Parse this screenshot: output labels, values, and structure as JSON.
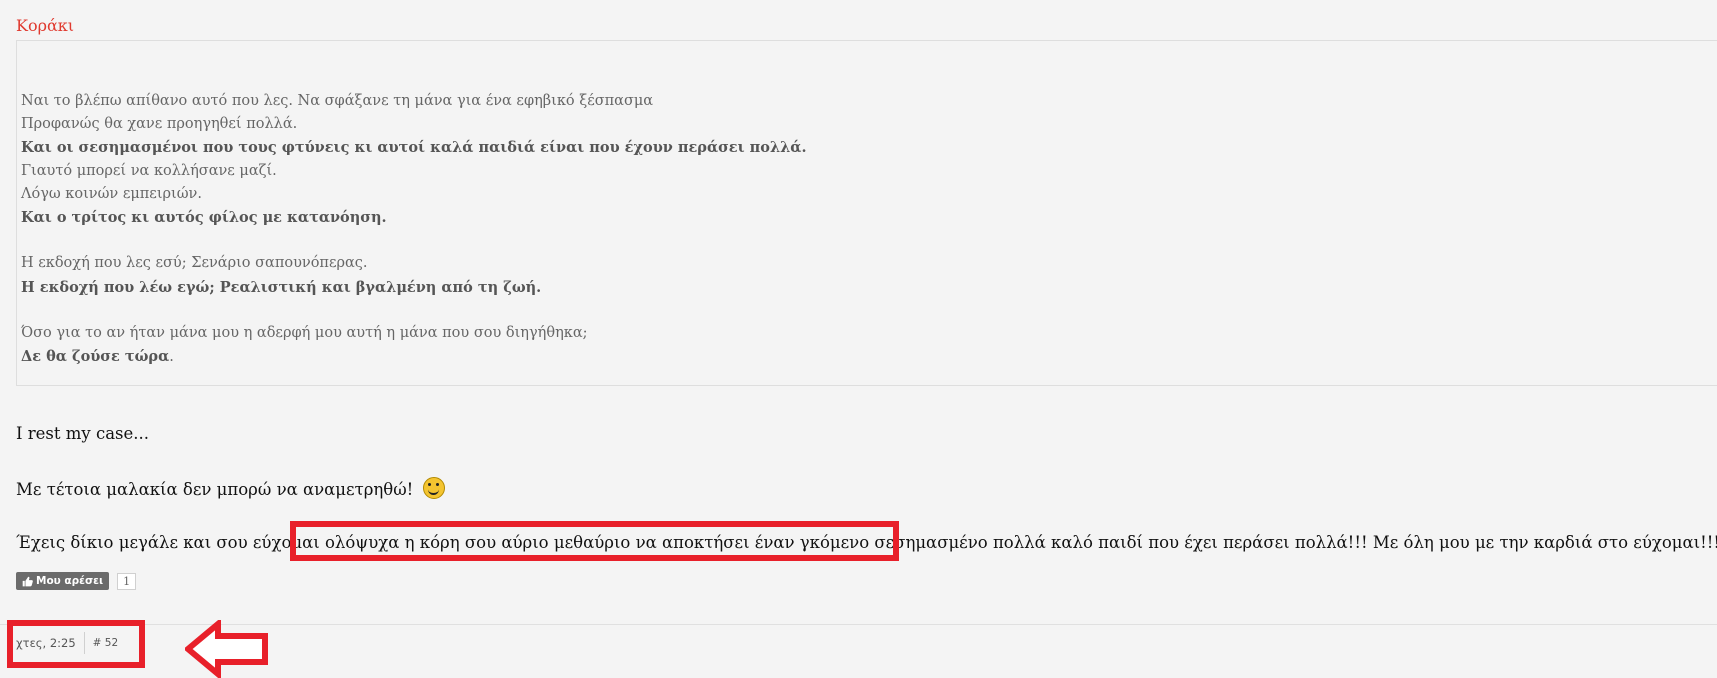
{
  "quote": {
    "author": "Κοράκι",
    "lines": [
      {
        "text": "Ναι το βλέπω απίθανο αυτό που λες. Να σφάξανε τη μάνα για ένα εφηβικό ξέσπασμα",
        "bold": false
      },
      {
        "text": "Προφανώς θα χανε προηγηθεί πολλά.",
        "bold": false
      },
      {
        "text": "Και οι σεσημασμένοι που τους φτύνεις κι αυτοί καλά παιδιά είναι που έχουν περάσει πολλά.",
        "bold": true
      },
      {
        "text": "Γιαυτό μπορεί να κολλήσανε μαζί.",
        "bold": false
      },
      {
        "text": "Λόγω κοινών εμπειριών.",
        "bold": false
      },
      {
        "text": "Και ο τρίτος κι αυτός φίλος με κατανόηση.",
        "bold": true
      },
      {
        "text": "",
        "bold": false
      },
      {
        "text": "Η εκδοχή που λες εσύ; Σενάριο σαπουνόπερας.",
        "bold": false
      },
      {
        "text": "Η εκδοχή που λέω εγώ; Ρεαλιστική και βγαλμένη από τη ζωή.",
        "bold": true
      },
      {
        "text": "",
        "bold": false
      },
      {
        "text": "Όσο για το αν ήταν μάνα μου η αδερφή μου αυτή η μάνα που σου διηγήθηκα;",
        "bold": false
      }
    ],
    "last_bold": "Δε θα ζούσε τώρα",
    "last_tail": "."
  },
  "post": {
    "line1": "I rest my case...",
    "line2": "Με τέτοια μαλακία δεν μπορώ να αναμετρηθώ!",
    "line3_a": "Έχεις δίκιο μεγάλε και σου εύχομαι ",
    "line3_b": "ολόψυχα η κόρη σου αύριο μεθαύριο να αποκτήσει έναν γκόμενο σεσημασμένο",
    "line3_c": " πολλά καλό παιδί που έχει περάσει πολλά!!! Με όλη μου με την καρδιά στο εύχομαι!!!! "
  },
  "icons": {
    "smiley1": "laughing-smiley-icon",
    "smiley2": "tongue-smiley-icon",
    "like": "thumbs-up-icon"
  },
  "like": {
    "label": "Μου αρέσει",
    "count": "1"
  },
  "meta": {
    "time": "χτες, 2:25",
    "post_number": "# 52"
  },
  "colors": {
    "accent": "#e03a2f",
    "annotation": "#e8202a"
  }
}
